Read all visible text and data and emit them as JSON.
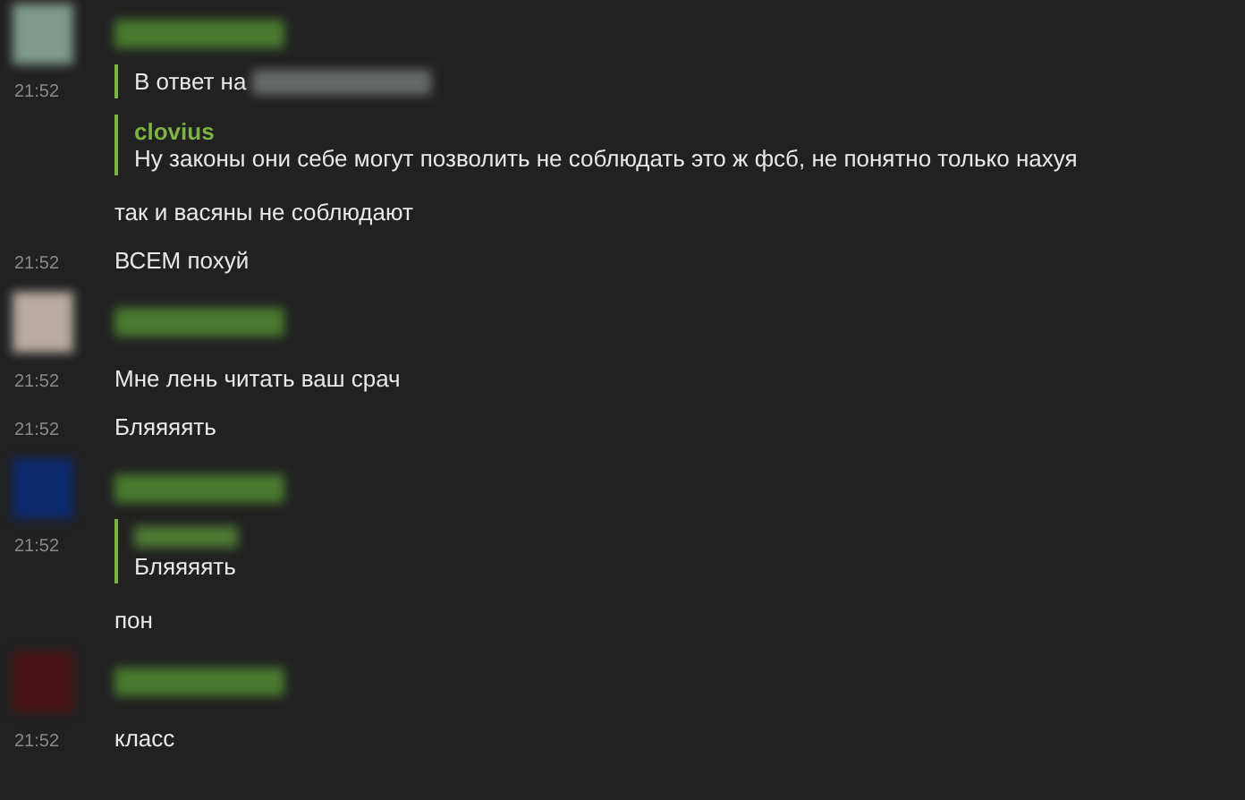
{
  "messages": [
    {
      "color": "#7f9a8c",
      "lines": [
        {
          "kind": "reply",
          "time": "21:52",
          "text": "В ответ на"
        },
        {
          "kind": "quote",
          "author": "clovius",
          "text": "Ну законы они себе могут позволить не соблюдать это ж фсб, не понятно только нахуя"
        },
        {
          "kind": "text",
          "text": "так и васяны не соблюдают"
        },
        {
          "kind": "text",
          "time": "21:52",
          "text": "ВСЕМ похуй"
        }
      ]
    },
    {
      "color": "#b8aca2",
      "lines": [
        {
          "kind": "text",
          "time": "21:52",
          "text": "Мне лень читать ваш срач"
        },
        {
          "kind": "text",
          "time": "21:52",
          "text": "Бляяяять"
        }
      ]
    },
    {
      "color": "#0d2a6e",
      "lines": [
        {
          "kind": "quote",
          "time": "21:52",
          "text": "Бляяяять"
        },
        {
          "kind": "text",
          "text": "пон"
        }
      ]
    },
    {
      "color": "#4a1214",
      "lines": [
        {
          "kind": "text",
          "time": "21:52",
          "text": "класс"
        }
      ]
    }
  ]
}
